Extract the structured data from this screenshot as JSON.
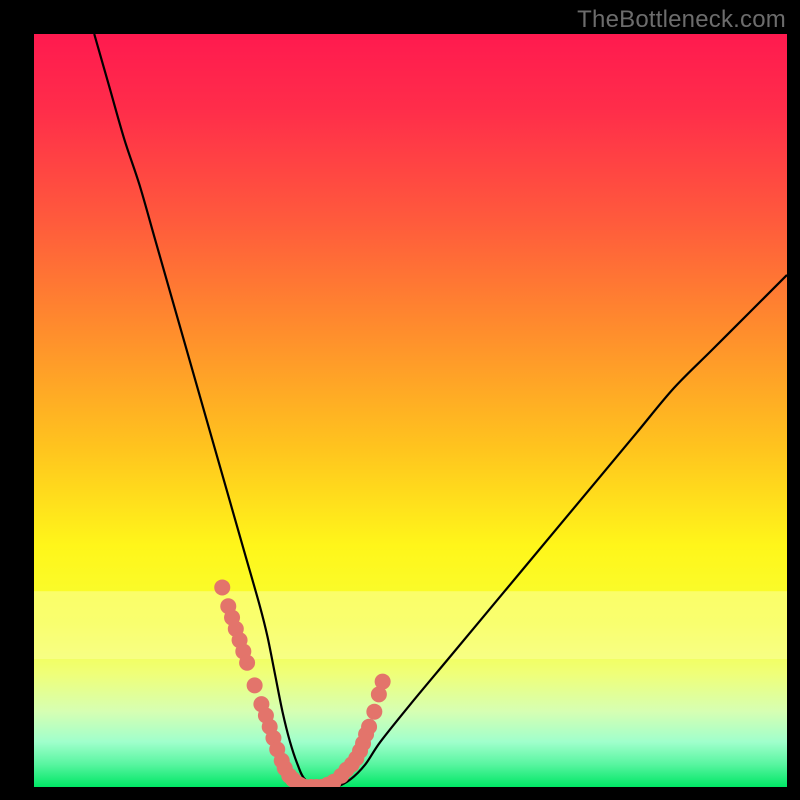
{
  "watermark": "TheBottleneck.com",
  "colors": {
    "frame": "#000000",
    "gradient_stops": [
      {
        "offset": 0.0,
        "color": "#ff1a4f"
      },
      {
        "offset": 0.1,
        "color": "#ff2d4a"
      },
      {
        "offset": 0.25,
        "color": "#ff5b3c"
      },
      {
        "offset": 0.4,
        "color": "#ff8f2c"
      },
      {
        "offset": 0.55,
        "color": "#ffc41e"
      },
      {
        "offset": 0.68,
        "color": "#fff61a"
      },
      {
        "offset": 0.78,
        "color": "#f7ff33"
      },
      {
        "offset": 0.85,
        "color": "#efff79"
      },
      {
        "offset": 0.9,
        "color": "#d6ffb3"
      },
      {
        "offset": 0.94,
        "color": "#a0ffcc"
      },
      {
        "offset": 0.97,
        "color": "#58f5a0"
      },
      {
        "offset": 1.0,
        "color": "#00e765"
      }
    ],
    "yellow_band": "#fcff9e",
    "curve": "#000000",
    "markers": "#e3746b"
  },
  "chart_data": {
    "type": "line",
    "title": "",
    "xlabel": "",
    "ylabel": "",
    "xlim": [
      0,
      100
    ],
    "ylim": [
      0,
      100
    ],
    "series": [
      {
        "name": "bottleneck-curve",
        "x": [
          8,
          10,
          12,
          14,
          16,
          18,
          20,
          22,
          24,
          26,
          28,
          30,
          31,
          32,
          33,
          34,
          35,
          36,
          38,
          40,
          42,
          44,
          46,
          50,
          55,
          60,
          65,
          70,
          75,
          80,
          85,
          90,
          95,
          100
        ],
        "y": [
          100,
          93,
          86,
          80,
          73,
          66,
          59,
          52,
          45,
          38,
          31,
          24,
          20,
          15,
          10,
          6,
          3,
          1,
          0,
          0,
          1,
          3,
          6,
          11,
          17,
          23,
          29,
          35,
          41,
          47,
          53,
          58,
          63,
          68
        ]
      }
    ],
    "markers": {
      "name": "highlight-dots",
      "x": [
        25.0,
        25.8,
        26.3,
        26.8,
        27.3,
        27.8,
        28.3,
        29.3,
        30.2,
        30.8,
        31.3,
        31.8,
        32.3,
        32.9,
        33.3,
        33.9,
        34.4,
        35.3,
        36.0,
        36.8,
        37.5,
        38.2,
        39.0,
        39.8,
        40.8,
        41.5,
        42.2,
        42.8,
        43.3,
        43.7,
        44.1,
        44.5,
        45.2,
        45.8,
        46.3
      ],
      "y": [
        26.5,
        24.0,
        22.5,
        21.0,
        19.5,
        18.0,
        16.5,
        13.5,
        11.0,
        9.5,
        8.0,
        6.5,
        5.0,
        3.5,
        2.5,
        1.5,
        1.0,
        0.3,
        0.0,
        0.0,
        0.0,
        0.0,
        0.3,
        0.7,
        1.5,
        2.3,
        3.0,
        3.8,
        4.8,
        5.8,
        7.0,
        8.0,
        10.0,
        12.3,
        14.0
      ]
    }
  }
}
